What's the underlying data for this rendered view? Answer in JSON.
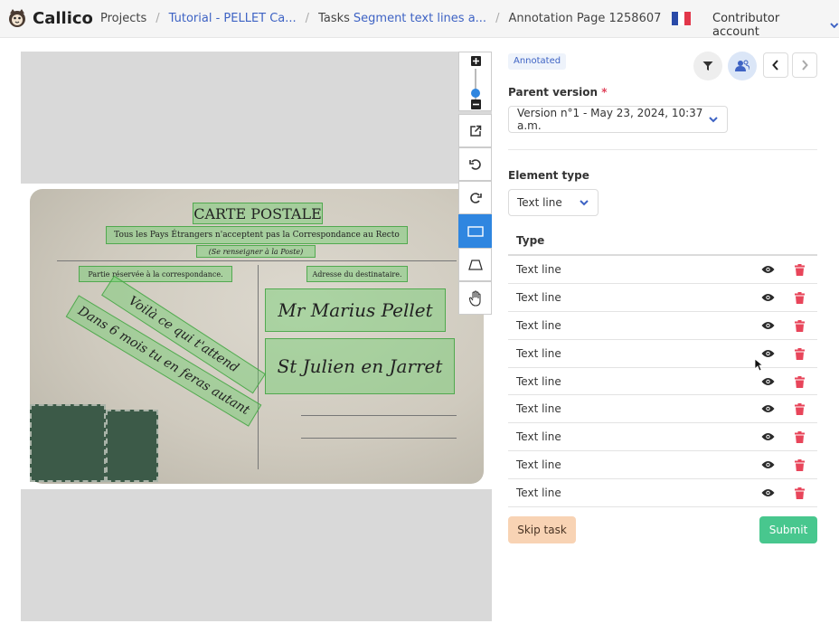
{
  "header": {
    "brand": "Callico",
    "breadcrumbs": {
      "projects": "Projects",
      "project": "Tutorial - PELLET Ca...",
      "tasks_prefix": "Tasks",
      "task": "Segment text lines a...",
      "page": "Annotation Page 1258607"
    },
    "flag_colors": [
      "#2a4aa8",
      "#ffffff",
      "#e2374a"
    ],
    "account": "Contributor account",
    "account_icon": "chevron-down-icon"
  },
  "viewer": {
    "postcard_text": {
      "title": "CARTE POSTALE",
      "subtitle": "Tous les Pays Étrangers n'acceptent pas la Correspondance au Recto",
      "note": "(Se renseigner à la Poste)",
      "left_header": "Partie réservée à la correspondance.",
      "right_header": "Adresse du destinataire.",
      "hand_line_1": "Voilà ce qui t'attend",
      "hand_line_2": "Dans 6 mois tu en feras autant",
      "address_1": "Mr Marius Pellet",
      "address_2": "St Julien en Jarret"
    },
    "tools": [
      "zoom-in-icon",
      "zoom-out-icon",
      "external-link-icon",
      "rotate-left-icon",
      "rotate-right-icon",
      "rectangle-icon",
      "polygon-icon",
      "hand-icon"
    ],
    "active_tool": "rectangle-icon",
    "zoom_level": 0.5,
    "accent_color": "#2f86e0",
    "overlay_color": "#66cc66"
  },
  "panel": {
    "status_tag": "Annotated",
    "filter_icon": "filter-icon",
    "users_icon": "users-icon",
    "prev_icon": "chevron-left-icon",
    "next_icon": "chevron-right-icon",
    "parent_version_label": "Parent version",
    "parent_version_value": "Version n°1 - May 23, 2024, 10:37 a.m.",
    "element_type_label": "Element type",
    "element_type_value": "Text line",
    "table_header": "Type",
    "rows": [
      {
        "type": "Text line"
      },
      {
        "type": "Text line"
      },
      {
        "type": "Text line"
      },
      {
        "type": "Text line"
      },
      {
        "type": "Text line"
      },
      {
        "type": "Text line"
      },
      {
        "type": "Text line"
      },
      {
        "type": "Text line"
      },
      {
        "type": "Text line"
      }
    ],
    "skip_label": "Skip task",
    "submit_label": "Submit",
    "skip_color": "#f8d3b4",
    "submit_color": "#48c78e",
    "delete_color": "#e8455a"
  }
}
